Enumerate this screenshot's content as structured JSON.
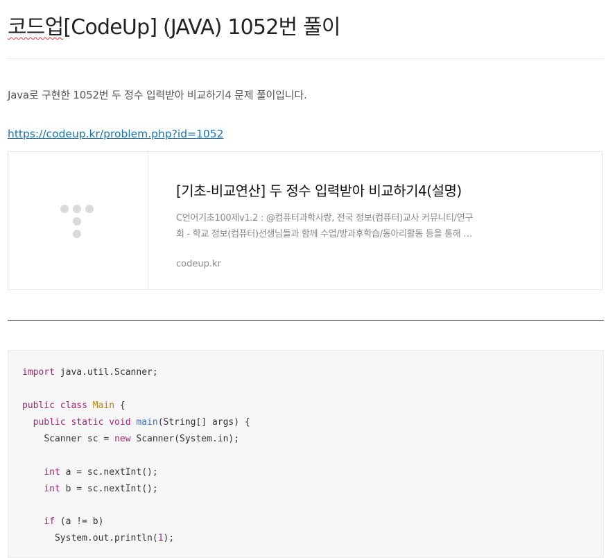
{
  "post": {
    "title_prefix": "코드업",
    "title_rest": "[CodeUp] (JAVA) 1052번 풀이",
    "intro": "Java로 구현한 1052번 두 정수 입력받아 비교하기4 문제 풀이입니다.",
    "link": "https://codeup.kr/problem.php?id=1052"
  },
  "card": {
    "title": "[기초-비교연산] 두 정수 입력받아 비교하기4(설명)",
    "desc_line1": "C언어기초100제v1.2 : @컴퓨터과학사랑, 전국 정보(컴퓨터)교사 커뮤니티/연구",
    "desc_line2": "회 - 학교 정보(컴퓨터)선생님들과 함께 수업/방과후학습/동아리활동 등을 통해 …",
    "domain": "codeup.kr"
  },
  "code": {
    "l1_kw": "import",
    "l1_rest": " java.util.Scanner;",
    "l2_kw": "public class",
    "l2_cls": "Main",
    "l2_rest": " {",
    "l3_kw": "public static void",
    "l3_fn": "main",
    "l3_rest": "(String[] args) {",
    "l4_a": "Scanner sc = ",
    "l4_kw": "new",
    "l4_b": " Scanner(System.in);",
    "l5_kw": "int",
    "l5_rest": " a = sc.nextInt();",
    "l6_kw": "int",
    "l6_rest": " b = sc.nextInt();",
    "l7_kw": "if",
    "l7_rest": " (a != b)",
    "l8_a": "System.out.println(",
    "l8_num": "1",
    "l8_b": ");"
  }
}
